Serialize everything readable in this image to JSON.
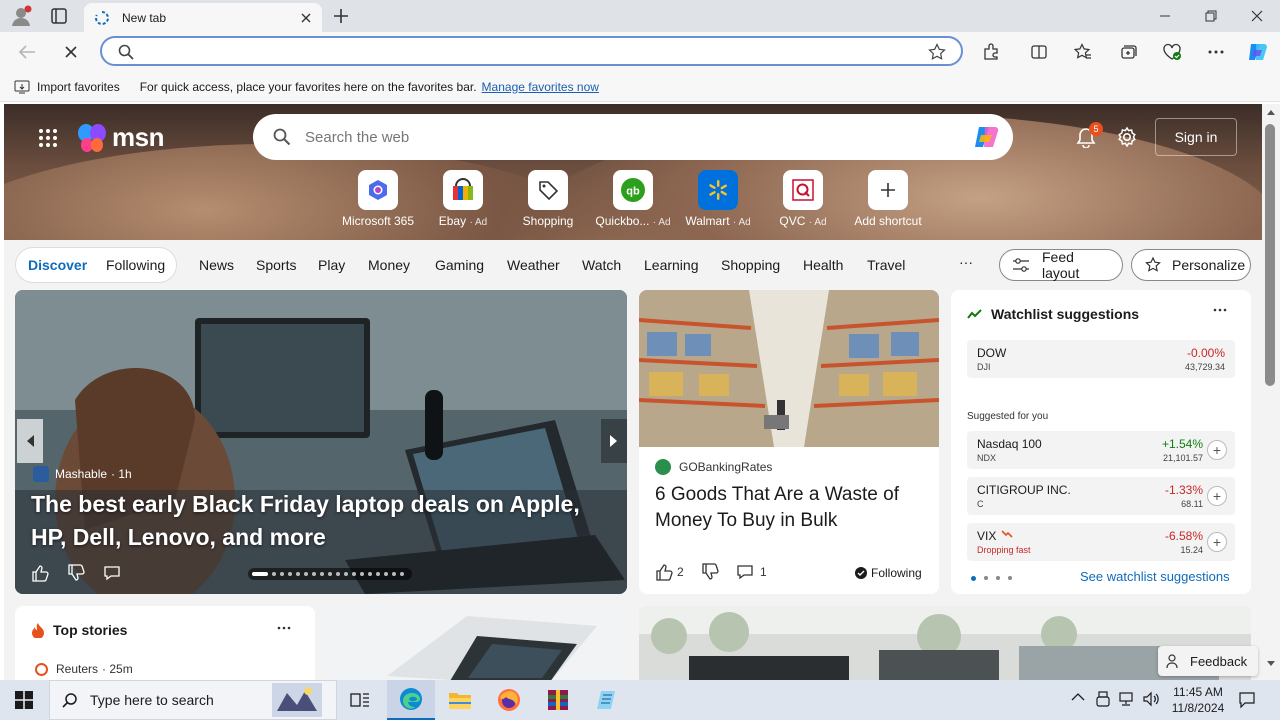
{
  "browser": {
    "tab_title": "New tab",
    "address_placeholder": "",
    "favorites_bar": {
      "import_label": "Import favorites",
      "hint_text": "For quick access, place your favorites here on the favorites bar.",
      "manage_link": "Manage favorites now"
    }
  },
  "msn": {
    "logo_text": "msn",
    "search_placeholder": "Search the web",
    "notification_count": "5",
    "signin_label": "Sign in",
    "shortcuts": [
      {
        "label": "Microsoft 365",
        "ad": "",
        "icon": "microsoft-365-icon"
      },
      {
        "label": "Ebay",
        "ad": "· Ad",
        "icon": "ebay-icon"
      },
      {
        "label": "Shopping",
        "ad": "",
        "icon": "shopping-tag-icon"
      },
      {
        "label": "Quickbo...",
        "ad": "· Ad",
        "icon": "quickbooks-icon"
      },
      {
        "label": "Walmart",
        "ad": "· Ad",
        "icon": "walmart-icon"
      },
      {
        "label": "QVC",
        "ad": "· Ad",
        "icon": "qvc-icon"
      },
      {
        "label": "Add shortcut",
        "ad": "",
        "icon": "plus-icon"
      }
    ],
    "nav": {
      "discover": "Discover",
      "following": "Following",
      "items": [
        "News",
        "Sports",
        "Play",
        "Money",
        "Gaming",
        "Weather",
        "Watch",
        "Learning",
        "Shopping",
        "Health",
        "Travel"
      ],
      "more": "···",
      "feed_layout": "Feed layout",
      "personalize": "Personalize"
    },
    "hero_story": {
      "source": "Mashable",
      "age": "· 1h",
      "headline": "The best early Black Friday laptop deals on Apple, HP, Dell, Lenovo, and more"
    },
    "mid_story": {
      "source": "GOBankingRates",
      "headline": "6 Goods That Are a Waste of Money To Buy in Bulk",
      "likes": "2",
      "comments": "1",
      "following_label": "Following"
    },
    "watchlist": {
      "title": "Watchlist suggestions",
      "main": {
        "name": "DOW",
        "symbol": "DJI",
        "change": "-0.00%",
        "value": "43,729.34"
      },
      "suggested_label": "Suggested for you",
      "suggestions": [
        {
          "name": "Nasdaq 100",
          "symbol": "NDX",
          "change": "+1.54%",
          "value": "21,101.57",
          "up": true,
          "note": ""
        },
        {
          "name": "CITIGROUP INC.",
          "symbol": "C",
          "change": "-1.33%",
          "value": "68.11",
          "up": false,
          "note": ""
        },
        {
          "name": "VIX",
          "symbol": "Dropping fast",
          "change": "-6.58%",
          "value": "15.24",
          "up": false,
          "note": "Dropping fast"
        }
      ],
      "see_link": "See watchlist suggestions"
    },
    "top_stories": {
      "title": "Top stories",
      "first_source": "Reuters",
      "first_age": "· 25m"
    },
    "feedback_label": "Feedback"
  },
  "taskbar": {
    "search_placeholder": "Type here to search",
    "time": "11:45 AM",
    "date": "11/8/2024"
  },
  "colors": {
    "accent": "#0f6cbd",
    "positive": "#107c10",
    "negative": "#c62828"
  }
}
